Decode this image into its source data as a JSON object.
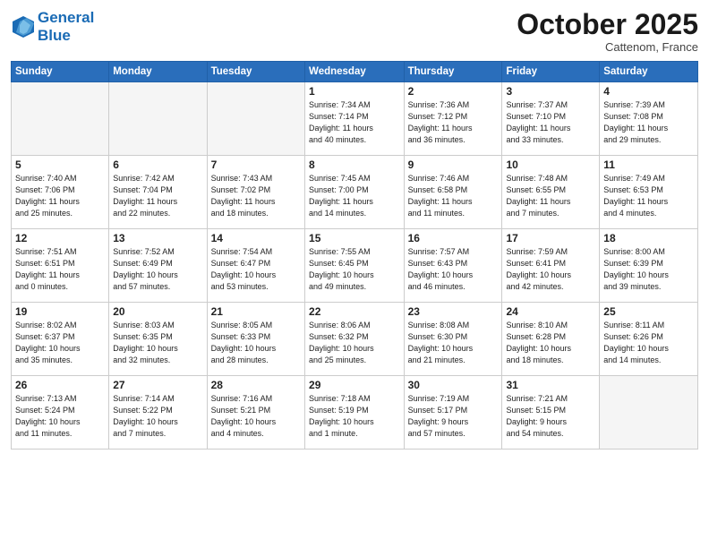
{
  "header": {
    "logo_line1": "General",
    "logo_line2": "Blue",
    "month": "October 2025",
    "location": "Cattenom, France"
  },
  "weekdays": [
    "Sunday",
    "Monday",
    "Tuesday",
    "Wednesday",
    "Thursday",
    "Friday",
    "Saturday"
  ],
  "weeks": [
    [
      {
        "day": "",
        "info": ""
      },
      {
        "day": "",
        "info": ""
      },
      {
        "day": "",
        "info": ""
      },
      {
        "day": "1",
        "info": "Sunrise: 7:34 AM\nSunset: 7:14 PM\nDaylight: 11 hours\nand 40 minutes."
      },
      {
        "day": "2",
        "info": "Sunrise: 7:36 AM\nSunset: 7:12 PM\nDaylight: 11 hours\nand 36 minutes."
      },
      {
        "day": "3",
        "info": "Sunrise: 7:37 AM\nSunset: 7:10 PM\nDaylight: 11 hours\nand 33 minutes."
      },
      {
        "day": "4",
        "info": "Sunrise: 7:39 AM\nSunset: 7:08 PM\nDaylight: 11 hours\nand 29 minutes."
      }
    ],
    [
      {
        "day": "5",
        "info": "Sunrise: 7:40 AM\nSunset: 7:06 PM\nDaylight: 11 hours\nand 25 minutes."
      },
      {
        "day": "6",
        "info": "Sunrise: 7:42 AM\nSunset: 7:04 PM\nDaylight: 11 hours\nand 22 minutes."
      },
      {
        "day": "7",
        "info": "Sunrise: 7:43 AM\nSunset: 7:02 PM\nDaylight: 11 hours\nand 18 minutes."
      },
      {
        "day": "8",
        "info": "Sunrise: 7:45 AM\nSunset: 7:00 PM\nDaylight: 11 hours\nand 14 minutes."
      },
      {
        "day": "9",
        "info": "Sunrise: 7:46 AM\nSunset: 6:58 PM\nDaylight: 11 hours\nand 11 minutes."
      },
      {
        "day": "10",
        "info": "Sunrise: 7:48 AM\nSunset: 6:55 PM\nDaylight: 11 hours\nand 7 minutes."
      },
      {
        "day": "11",
        "info": "Sunrise: 7:49 AM\nSunset: 6:53 PM\nDaylight: 11 hours\nand 4 minutes."
      }
    ],
    [
      {
        "day": "12",
        "info": "Sunrise: 7:51 AM\nSunset: 6:51 PM\nDaylight: 11 hours\nand 0 minutes."
      },
      {
        "day": "13",
        "info": "Sunrise: 7:52 AM\nSunset: 6:49 PM\nDaylight: 10 hours\nand 57 minutes."
      },
      {
        "day": "14",
        "info": "Sunrise: 7:54 AM\nSunset: 6:47 PM\nDaylight: 10 hours\nand 53 minutes."
      },
      {
        "day": "15",
        "info": "Sunrise: 7:55 AM\nSunset: 6:45 PM\nDaylight: 10 hours\nand 49 minutes."
      },
      {
        "day": "16",
        "info": "Sunrise: 7:57 AM\nSunset: 6:43 PM\nDaylight: 10 hours\nand 46 minutes."
      },
      {
        "day": "17",
        "info": "Sunrise: 7:59 AM\nSunset: 6:41 PM\nDaylight: 10 hours\nand 42 minutes."
      },
      {
        "day": "18",
        "info": "Sunrise: 8:00 AM\nSunset: 6:39 PM\nDaylight: 10 hours\nand 39 minutes."
      }
    ],
    [
      {
        "day": "19",
        "info": "Sunrise: 8:02 AM\nSunset: 6:37 PM\nDaylight: 10 hours\nand 35 minutes."
      },
      {
        "day": "20",
        "info": "Sunrise: 8:03 AM\nSunset: 6:35 PM\nDaylight: 10 hours\nand 32 minutes."
      },
      {
        "day": "21",
        "info": "Sunrise: 8:05 AM\nSunset: 6:33 PM\nDaylight: 10 hours\nand 28 minutes."
      },
      {
        "day": "22",
        "info": "Sunrise: 8:06 AM\nSunset: 6:32 PM\nDaylight: 10 hours\nand 25 minutes."
      },
      {
        "day": "23",
        "info": "Sunrise: 8:08 AM\nSunset: 6:30 PM\nDaylight: 10 hours\nand 21 minutes."
      },
      {
        "day": "24",
        "info": "Sunrise: 8:10 AM\nSunset: 6:28 PM\nDaylight: 10 hours\nand 18 minutes."
      },
      {
        "day": "25",
        "info": "Sunrise: 8:11 AM\nSunset: 6:26 PM\nDaylight: 10 hours\nand 14 minutes."
      }
    ],
    [
      {
        "day": "26",
        "info": "Sunrise: 7:13 AM\nSunset: 5:24 PM\nDaylight: 10 hours\nand 11 minutes."
      },
      {
        "day": "27",
        "info": "Sunrise: 7:14 AM\nSunset: 5:22 PM\nDaylight: 10 hours\nand 7 minutes."
      },
      {
        "day": "28",
        "info": "Sunrise: 7:16 AM\nSunset: 5:21 PM\nDaylight: 10 hours\nand 4 minutes."
      },
      {
        "day": "29",
        "info": "Sunrise: 7:18 AM\nSunset: 5:19 PM\nDaylight: 10 hours\nand 1 minute."
      },
      {
        "day": "30",
        "info": "Sunrise: 7:19 AM\nSunset: 5:17 PM\nDaylight: 9 hours\nand 57 minutes."
      },
      {
        "day": "31",
        "info": "Sunrise: 7:21 AM\nSunset: 5:15 PM\nDaylight: 9 hours\nand 54 minutes."
      },
      {
        "day": "",
        "info": ""
      }
    ]
  ]
}
